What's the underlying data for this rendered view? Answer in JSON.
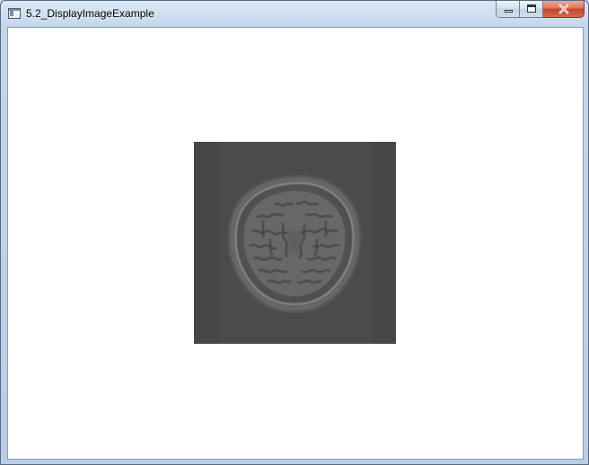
{
  "window": {
    "title": "5.2_DisplayImageExample",
    "buttons": {
      "minimize_icon": "minimize-icon",
      "maximize_icon": "maximize-icon",
      "close_icon": "close-icon"
    }
  },
  "content": {
    "image_description_icon": "brain-mri-slice",
    "image_background": "#474747",
    "window_background": "#ffffff"
  }
}
